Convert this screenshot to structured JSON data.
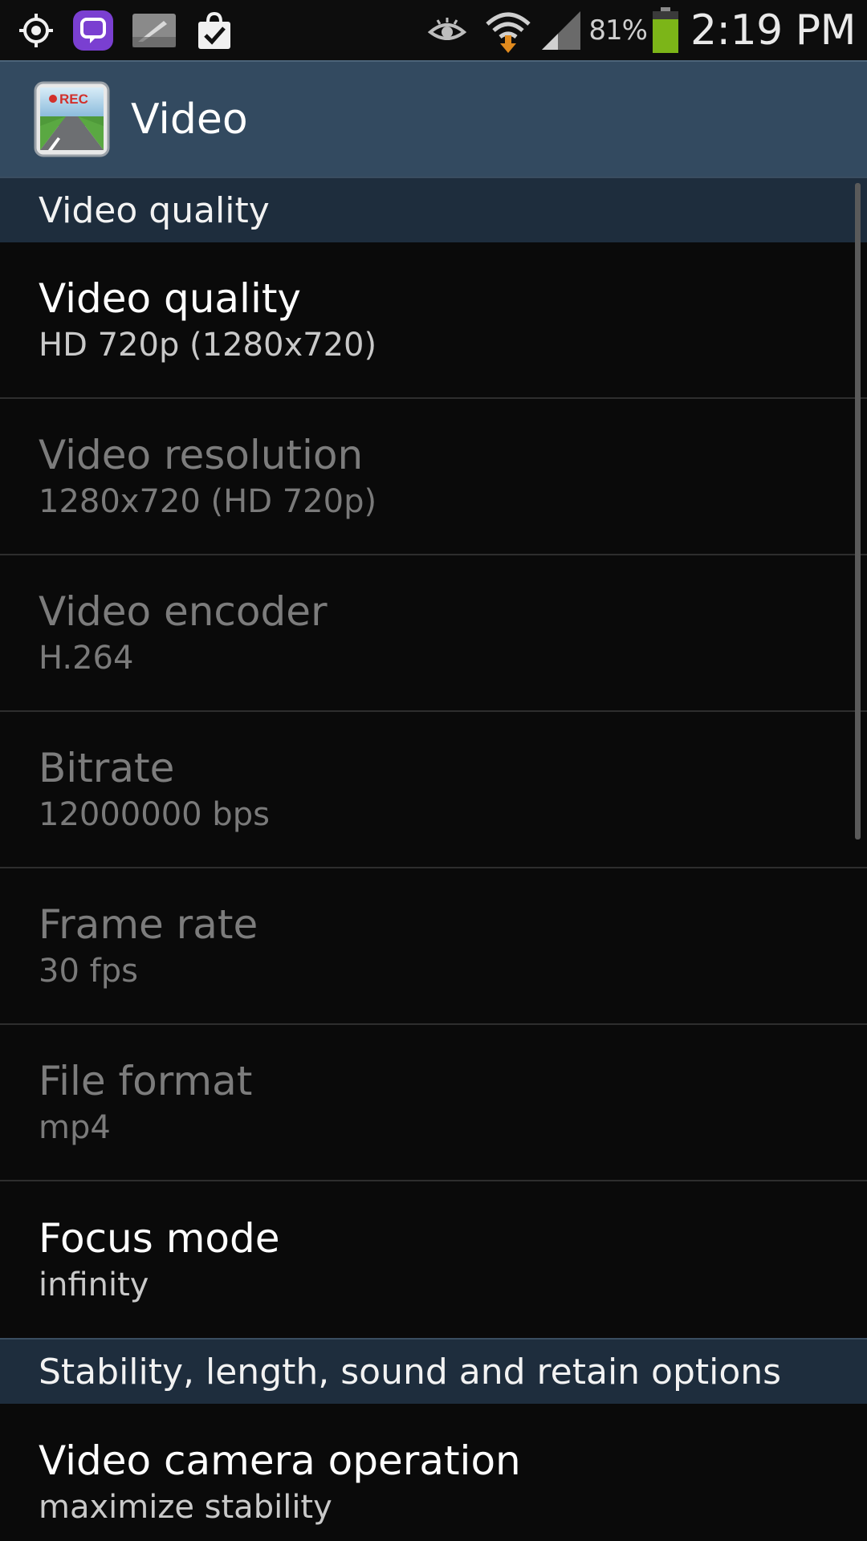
{
  "status_bar": {
    "icons_left": [
      "gps-icon",
      "viber-icon",
      "gallery-icon",
      "shopping-bag-check-icon"
    ],
    "icons_right": [
      "eye-icon",
      "wifi-download-icon",
      "signal-icon"
    ],
    "battery_percent": "81%",
    "battery_level": 0.81,
    "battery_color": "#7cb518",
    "time": "2:19 PM"
  },
  "action_bar": {
    "icon": "rec-camera-app-icon",
    "icon_badge": "REC",
    "title": "Video"
  },
  "sections": [
    {
      "header": "Video quality",
      "items": [
        {
          "title": "Video quality",
          "summary": "HD 720p (1280x720)",
          "enabled": true
        },
        {
          "title": "Video resolution",
          "summary": "1280x720 (HD 720p)",
          "enabled": false
        },
        {
          "title": "Video encoder",
          "summary": "H.264",
          "enabled": false
        },
        {
          "title": "Bitrate",
          "summary": "12000000 bps",
          "enabled": false
        },
        {
          "title": "Frame rate",
          "summary": "30 fps",
          "enabled": false
        },
        {
          "title": "File format",
          "summary": "mp4",
          "enabled": false
        },
        {
          "title": "Focus mode",
          "summary": "infinity",
          "enabled": true
        }
      ]
    },
    {
      "header": "Stability, length, sound and retain options",
      "items": [
        {
          "title": "Video camera operation",
          "summary": "maximize stability",
          "enabled": true
        }
      ]
    }
  ],
  "colors": {
    "action_bar": "#334a60",
    "category_header": "#1e2d3d",
    "background": "#0a0a0a"
  }
}
